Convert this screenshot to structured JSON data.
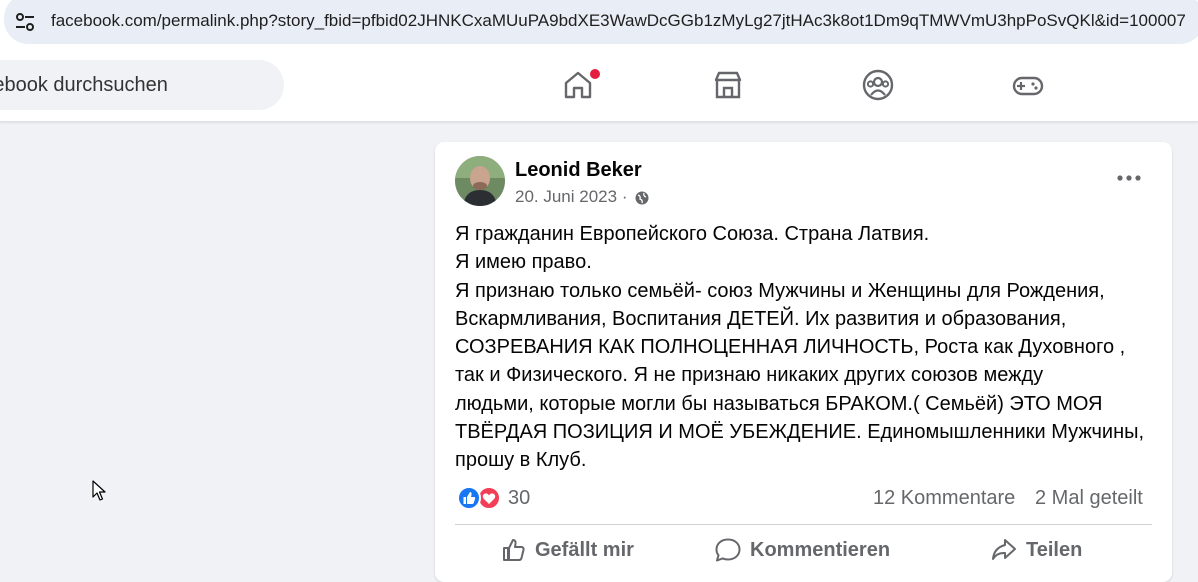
{
  "browser": {
    "url": "facebook.com/permalink.php?story_fbid=pfbid02JHNKCxaMUuPA9bdXE3WawDcGGb1zMyLg27jtHAc3k8ot1Dm9qTMWVmU3hpPoSvQKl&id=100007"
  },
  "facebook": {
    "search_placeholder": "Facebook durchsuchen",
    "nav": {
      "home": "home-icon",
      "marketplace": "marketplace-icon",
      "groups": "groups-icon",
      "gaming": "gaming-icon"
    }
  },
  "post": {
    "author": "Leonid Beker",
    "date": "20. Juni 2023",
    "separator": "·",
    "audience_icon": "globe-icon",
    "text_lines": [
      "Я гражданин Европейского Союза. Страна Латвия.",
      "Я имею право.",
      "Я признаю только семьёй- союз Мужчины и Женщины для Рождения,",
      "Вскармливания, Воспитания  ДЕТЕЙ. Их развития и образования,",
      "СОЗРЕВАНИЯ КАК ПОЛНОЦЕННАЯ ЛИЧНОСТЬ, Роста как Духовного ,",
      "так и Физического. Я не признаю никаких других союзов между",
      "людьми, которые могли бы называться БРАКОМ.( Семьёй)  ЭТО МОЯ",
      "ТВЁРДАЯ ПОЗИЦИЯ И МОЁ УБЕЖДЕНИЕ. Единомышленники Мужчины,",
      "прошу в Клуб."
    ],
    "reaction_count": "30",
    "comments": "12 Kommentare",
    "shares": "2 Mal geteilt",
    "actions": {
      "like": "Gefällt mir",
      "comment": "Kommentieren",
      "share": "Teilen"
    }
  }
}
